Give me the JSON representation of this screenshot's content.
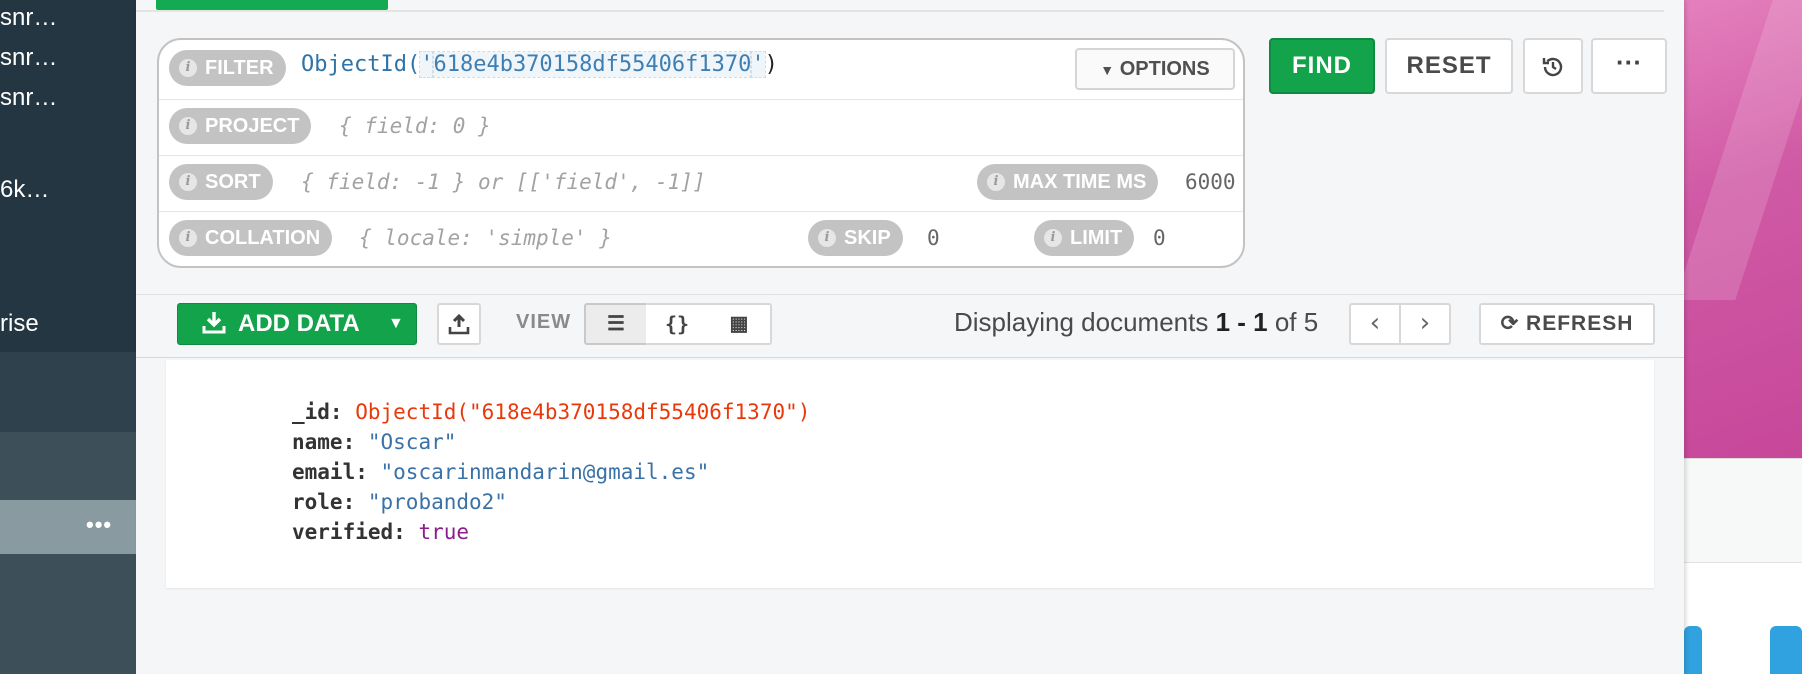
{
  "sidebar": {
    "items": [
      "snr…",
      "snr…",
      "snr…",
      "6k…",
      "rise"
    ],
    "more_label": "•••"
  },
  "query": {
    "filter_label": "FILTER",
    "filter_fn": "ObjectId(",
    "filter_q1": "'",
    "filter_value": "618e4b370158df55406f1370",
    "filter_q2": "'",
    "filter_close": ")",
    "options_label": "OPTIONS",
    "project_label": "PROJECT",
    "project_placeholder": "{ field: 0 }",
    "sort_label": "SORT",
    "sort_placeholder": "{ field: -1 } or [['field', -1]]",
    "max_time_label": "MAX TIME MS",
    "max_time_value": "6000",
    "collation_label": "COLLATION",
    "collation_placeholder": "{ locale: 'simple' }",
    "skip_label": "SKIP",
    "skip_value": "0",
    "limit_label": "LIMIT",
    "limit_value": "0"
  },
  "actions": {
    "find": "FIND",
    "reset": "RESET",
    "history_icon": "history-icon",
    "more": "···"
  },
  "toolbar": {
    "add_data": "ADD DATA",
    "view_label": "VIEW",
    "list_icon": "☰",
    "json_icon": "{}",
    "table_icon": "▦",
    "displaying_prefix": "Displaying documents ",
    "range": "1 - 1",
    "of_text": " of ",
    "total": "5",
    "prev": "‹",
    "next": "›",
    "refresh": "REFRESH"
  },
  "document": {
    "fields": [
      {
        "key": "_id:",
        "value": "ObjectId(\"618e4b370158df55406f1370\")"
      },
      {
        "key": "name:",
        "value": "\"Oscar\""
      },
      {
        "key": "email:",
        "value": "\"oscarinmandarin@gmail.es\""
      },
      {
        "key": "role:",
        "value": "\"probando2\""
      },
      {
        "key": "verified:",
        "value": "true"
      }
    ]
  },
  "colors": {
    "accent_green": "#12a34b",
    "oid_red": "#e9390b",
    "string_blue": "#3a72a8",
    "bool_purple": "#8b1d8d",
    "sidebar_dark": "#243641"
  }
}
